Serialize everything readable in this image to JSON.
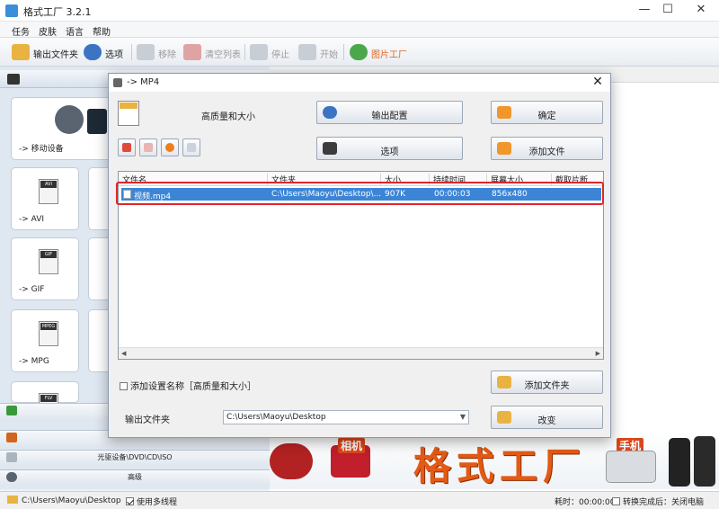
{
  "app": {
    "title": "格式工厂 3.2.1",
    "window_controls": [
      "—",
      "☐",
      "✕"
    ]
  },
  "menu": [
    "任务",
    "皮肤",
    "语言",
    "帮助"
  ],
  "toolbar": {
    "output_folder": "输出文件夹",
    "options": "选项",
    "remove": "移除",
    "clear_list": "清空列表",
    "stop": "停止",
    "start": "开始",
    "picture_factory": "图片工厂"
  },
  "left_panel": {
    "tiles": [
      {
        "label": "-> 移动设备"
      },
      {
        "label": "-> AVI",
        "tag": "AVI"
      },
      {
        "label": "-> GIF",
        "tag": "GIF"
      },
      {
        "label": "-> MPG",
        "tag": "MPEG"
      },
      {
        "tag": "FLV"
      }
    ],
    "categories": [
      "光驱设备\\DVD\\CD\\ISO",
      "高级"
    ]
  },
  "banner": {
    "brand": "格式工厂",
    "camera": "相机",
    "phone": "手机"
  },
  "statusbar": {
    "path": "C:\\Users\\Maoyu\\Desktop",
    "multithread": "使用多线程",
    "elapsed": "耗时：00:00:00",
    "shutdown": "转换完成后：关闭电脑"
  },
  "dialog": {
    "title": "-> MP4",
    "quality": "高质量和大小",
    "buttons": {
      "output_config": "输出配置",
      "ok": "确定",
      "options": "选项",
      "add_file": "添加文件",
      "add_folder": "添加文件夹",
      "change": "改变"
    },
    "columns": [
      "文件名",
      "文件夹",
      "大小",
      "持续时间",
      "屏幕大小",
      "截取片断"
    ],
    "rows": [
      {
        "name": "视频.mp4",
        "folder": "C:\\Users\\Maoyu\\Desktop\\...",
        "size": "907K",
        "duration": "00:00:03",
        "screen": "856x480",
        "clip": ""
      }
    ],
    "add_setting_name": "添加设置名称［高质量和大小］",
    "output_folder_label": "输出文件夹",
    "output_folder_value": "C:\\Users\\Maoyu\\Desktop"
  }
}
